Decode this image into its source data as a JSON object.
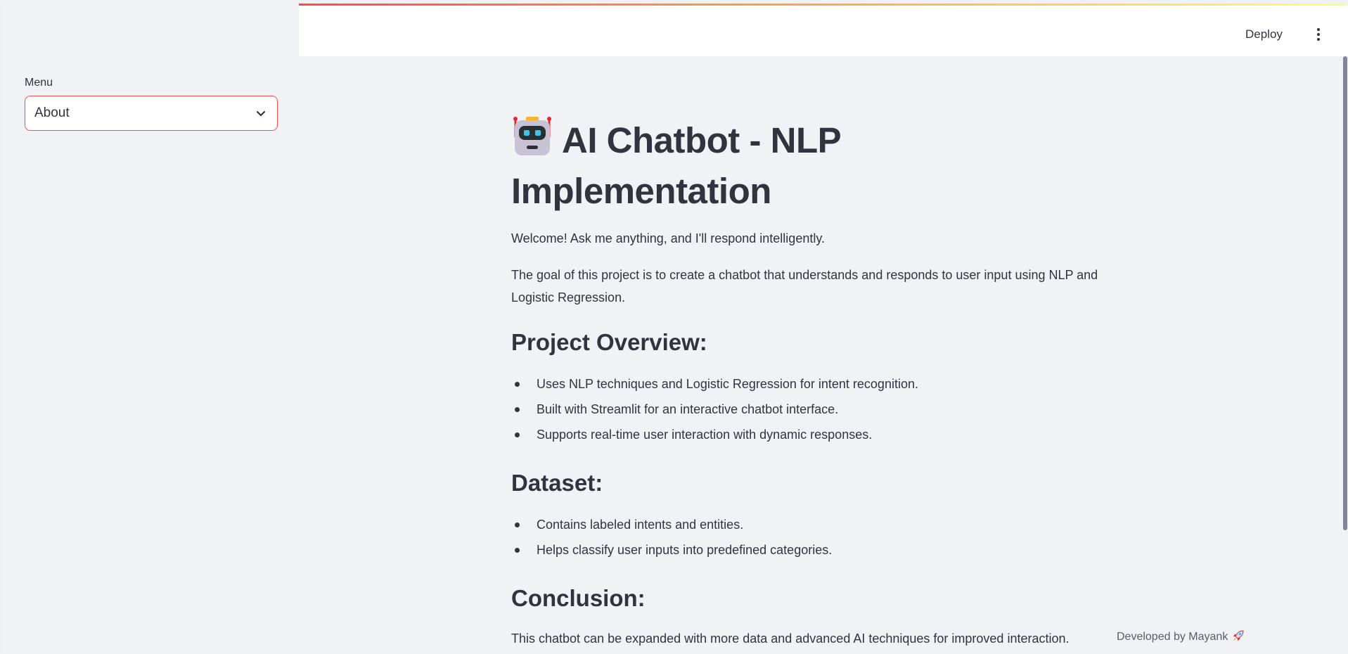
{
  "header": {
    "deploy_label": "Deploy",
    "menu_icon": "kebab-menu-icon",
    "accent_gradient": [
      "#ff4b4b",
      "#ffbd45",
      "#fffd80"
    ]
  },
  "sidebar": {
    "menu_label": "Menu",
    "menu_selected": "About",
    "select_border_color": "#ff4b4b"
  },
  "main": {
    "title_icon": "robot-icon",
    "title": "AI Chatbot - NLP Implementation",
    "welcome": "Welcome! Ask me anything, and I'll respond intelligently.",
    "goal": "The goal of this project is to create a chatbot that understands and responds to user input using NLP and Logistic Regression.",
    "sections": [
      {
        "heading": "Project Overview:",
        "items": [
          "Uses NLP techniques and Logistic Regression for intent recognition.",
          "Built with Streamlit for an interactive chatbot interface.",
          "Supports real-time user interaction with dynamic responses."
        ]
      },
      {
        "heading": "Dataset:",
        "items": [
          "Contains labeled intents and entities.",
          "Helps classify user inputs into predefined categories."
        ]
      },
      {
        "heading": "Conclusion:",
        "text": "This chatbot can be expanded with more data and advanced AI techniques for improved interaction."
      }
    ]
  },
  "footer": {
    "text": "Developed by Mayank",
    "icon": "rocket-icon"
  }
}
